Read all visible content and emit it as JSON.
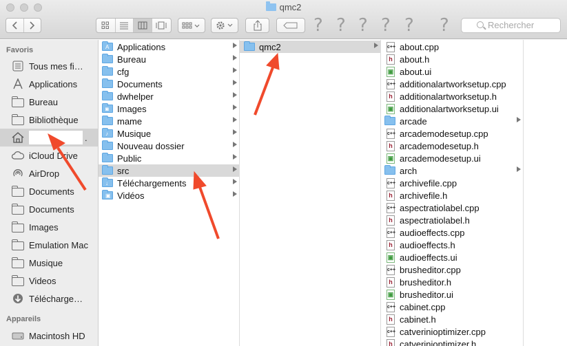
{
  "window": {
    "title": "qmc2"
  },
  "toolbar": {
    "back_icon": "chevron-left",
    "forward_icon": "chevron-right",
    "view_icons": [
      "icon-view",
      "list-view",
      "column-view",
      "coverflow-view"
    ],
    "arrange_icon": "grid-arrange",
    "action_icon": "gear",
    "share_icon": "share",
    "tag_icon": "tag",
    "unknown_placeholders": [
      "?",
      "?",
      "?",
      "?",
      "?"
    ],
    "search_placeholder": "Rechercher"
  },
  "sidebar": {
    "favorites_heading": "Favoris",
    "favorites": [
      {
        "label": "Tous mes fi…",
        "icon": "all-files-icon"
      },
      {
        "label": "Applications",
        "icon": "applications-icon"
      },
      {
        "label": "Bureau",
        "icon": "folder-icon"
      },
      {
        "label": "Bibliothèque",
        "icon": "folder-icon"
      },
      {
        "label": ".",
        "icon": "home-icon",
        "selected": true
      },
      {
        "label": "iCloud Drive",
        "icon": "cloud-icon"
      },
      {
        "label": "AirDrop",
        "icon": "airdrop-icon"
      },
      {
        "label": "Documents",
        "icon": "folder-icon"
      },
      {
        "label": "Documents",
        "icon": "folder-icon"
      },
      {
        "label": "Images",
        "icon": "folder-icon"
      },
      {
        "label": "Emulation Mac",
        "icon": "folder-icon"
      },
      {
        "label": "Musique",
        "icon": "folder-icon"
      },
      {
        "label": "Videos",
        "icon": "folder-icon"
      },
      {
        "label": "Télécharge…",
        "icon": "downloads-icon"
      }
    ],
    "devices_heading": "Appareils",
    "devices": [
      {
        "label": "Macintosh HD",
        "icon": "disk-icon"
      }
    ]
  },
  "columns": [
    {
      "items": [
        {
          "name": "Applications",
          "glyph": "A"
        },
        {
          "name": "Bureau",
          "glyph": ""
        },
        {
          "name": "cfg",
          "glyph": ""
        },
        {
          "name": "Documents",
          "glyph": ""
        },
        {
          "name": "dwhelper",
          "glyph": ""
        },
        {
          "name": "Images",
          "glyph": "◙"
        },
        {
          "name": "mame",
          "glyph": ""
        },
        {
          "name": "Musique",
          "glyph": "♪"
        },
        {
          "name": "Nouveau dossier",
          "glyph": ""
        },
        {
          "name": "Public",
          "glyph": ""
        },
        {
          "name": "src",
          "glyph": "",
          "selected": true
        },
        {
          "name": "Téléchargements",
          "glyph": "↓"
        },
        {
          "name": "Vidéos",
          "glyph": "▣"
        }
      ]
    },
    {
      "items": [
        {
          "name": "qmc2",
          "selected": true
        }
      ]
    },
    {
      "items": [
        {
          "name": "about.cpp",
          "type": "cpp"
        },
        {
          "name": "about.h",
          "type": "h"
        },
        {
          "name": "about.ui",
          "type": "ui"
        },
        {
          "name": "additionalartworksetup.cpp",
          "type": "cpp"
        },
        {
          "name": "additionalartworksetup.h",
          "type": "h"
        },
        {
          "name": "additionalartworksetup.ui",
          "type": "ui"
        },
        {
          "name": "arcade",
          "type": "folder"
        },
        {
          "name": "arcademodesetup.cpp",
          "type": "cpp"
        },
        {
          "name": "arcademodesetup.h",
          "type": "h"
        },
        {
          "name": "arcademodesetup.ui",
          "type": "ui"
        },
        {
          "name": "arch",
          "type": "folder"
        },
        {
          "name": "archivefile.cpp",
          "type": "cpp"
        },
        {
          "name": "archivefile.h",
          "type": "h"
        },
        {
          "name": "aspectratiolabel.cpp",
          "type": "cpp"
        },
        {
          "name": "aspectratiolabel.h",
          "type": "h"
        },
        {
          "name": "audioeffects.cpp",
          "type": "cpp"
        },
        {
          "name": "audioeffects.h",
          "type": "h"
        },
        {
          "name": "audioeffects.ui",
          "type": "ui"
        },
        {
          "name": "brusheditor.cpp",
          "type": "cpp"
        },
        {
          "name": "brusheditor.h",
          "type": "h"
        },
        {
          "name": "brusheditor.ui",
          "type": "ui"
        },
        {
          "name": "cabinet.cpp",
          "type": "cpp"
        },
        {
          "name": "cabinet.h",
          "type": "h"
        },
        {
          "name": "catverinioptimizer.cpp",
          "type": "cpp"
        },
        {
          "name": "catverinioptimizer.h",
          "type": "h"
        }
      ]
    }
  ],
  "colors": {
    "annotation_arrow": "#f04a2c",
    "folder_fill": "#86c0ee",
    "selection": "#d9d9d9"
  }
}
